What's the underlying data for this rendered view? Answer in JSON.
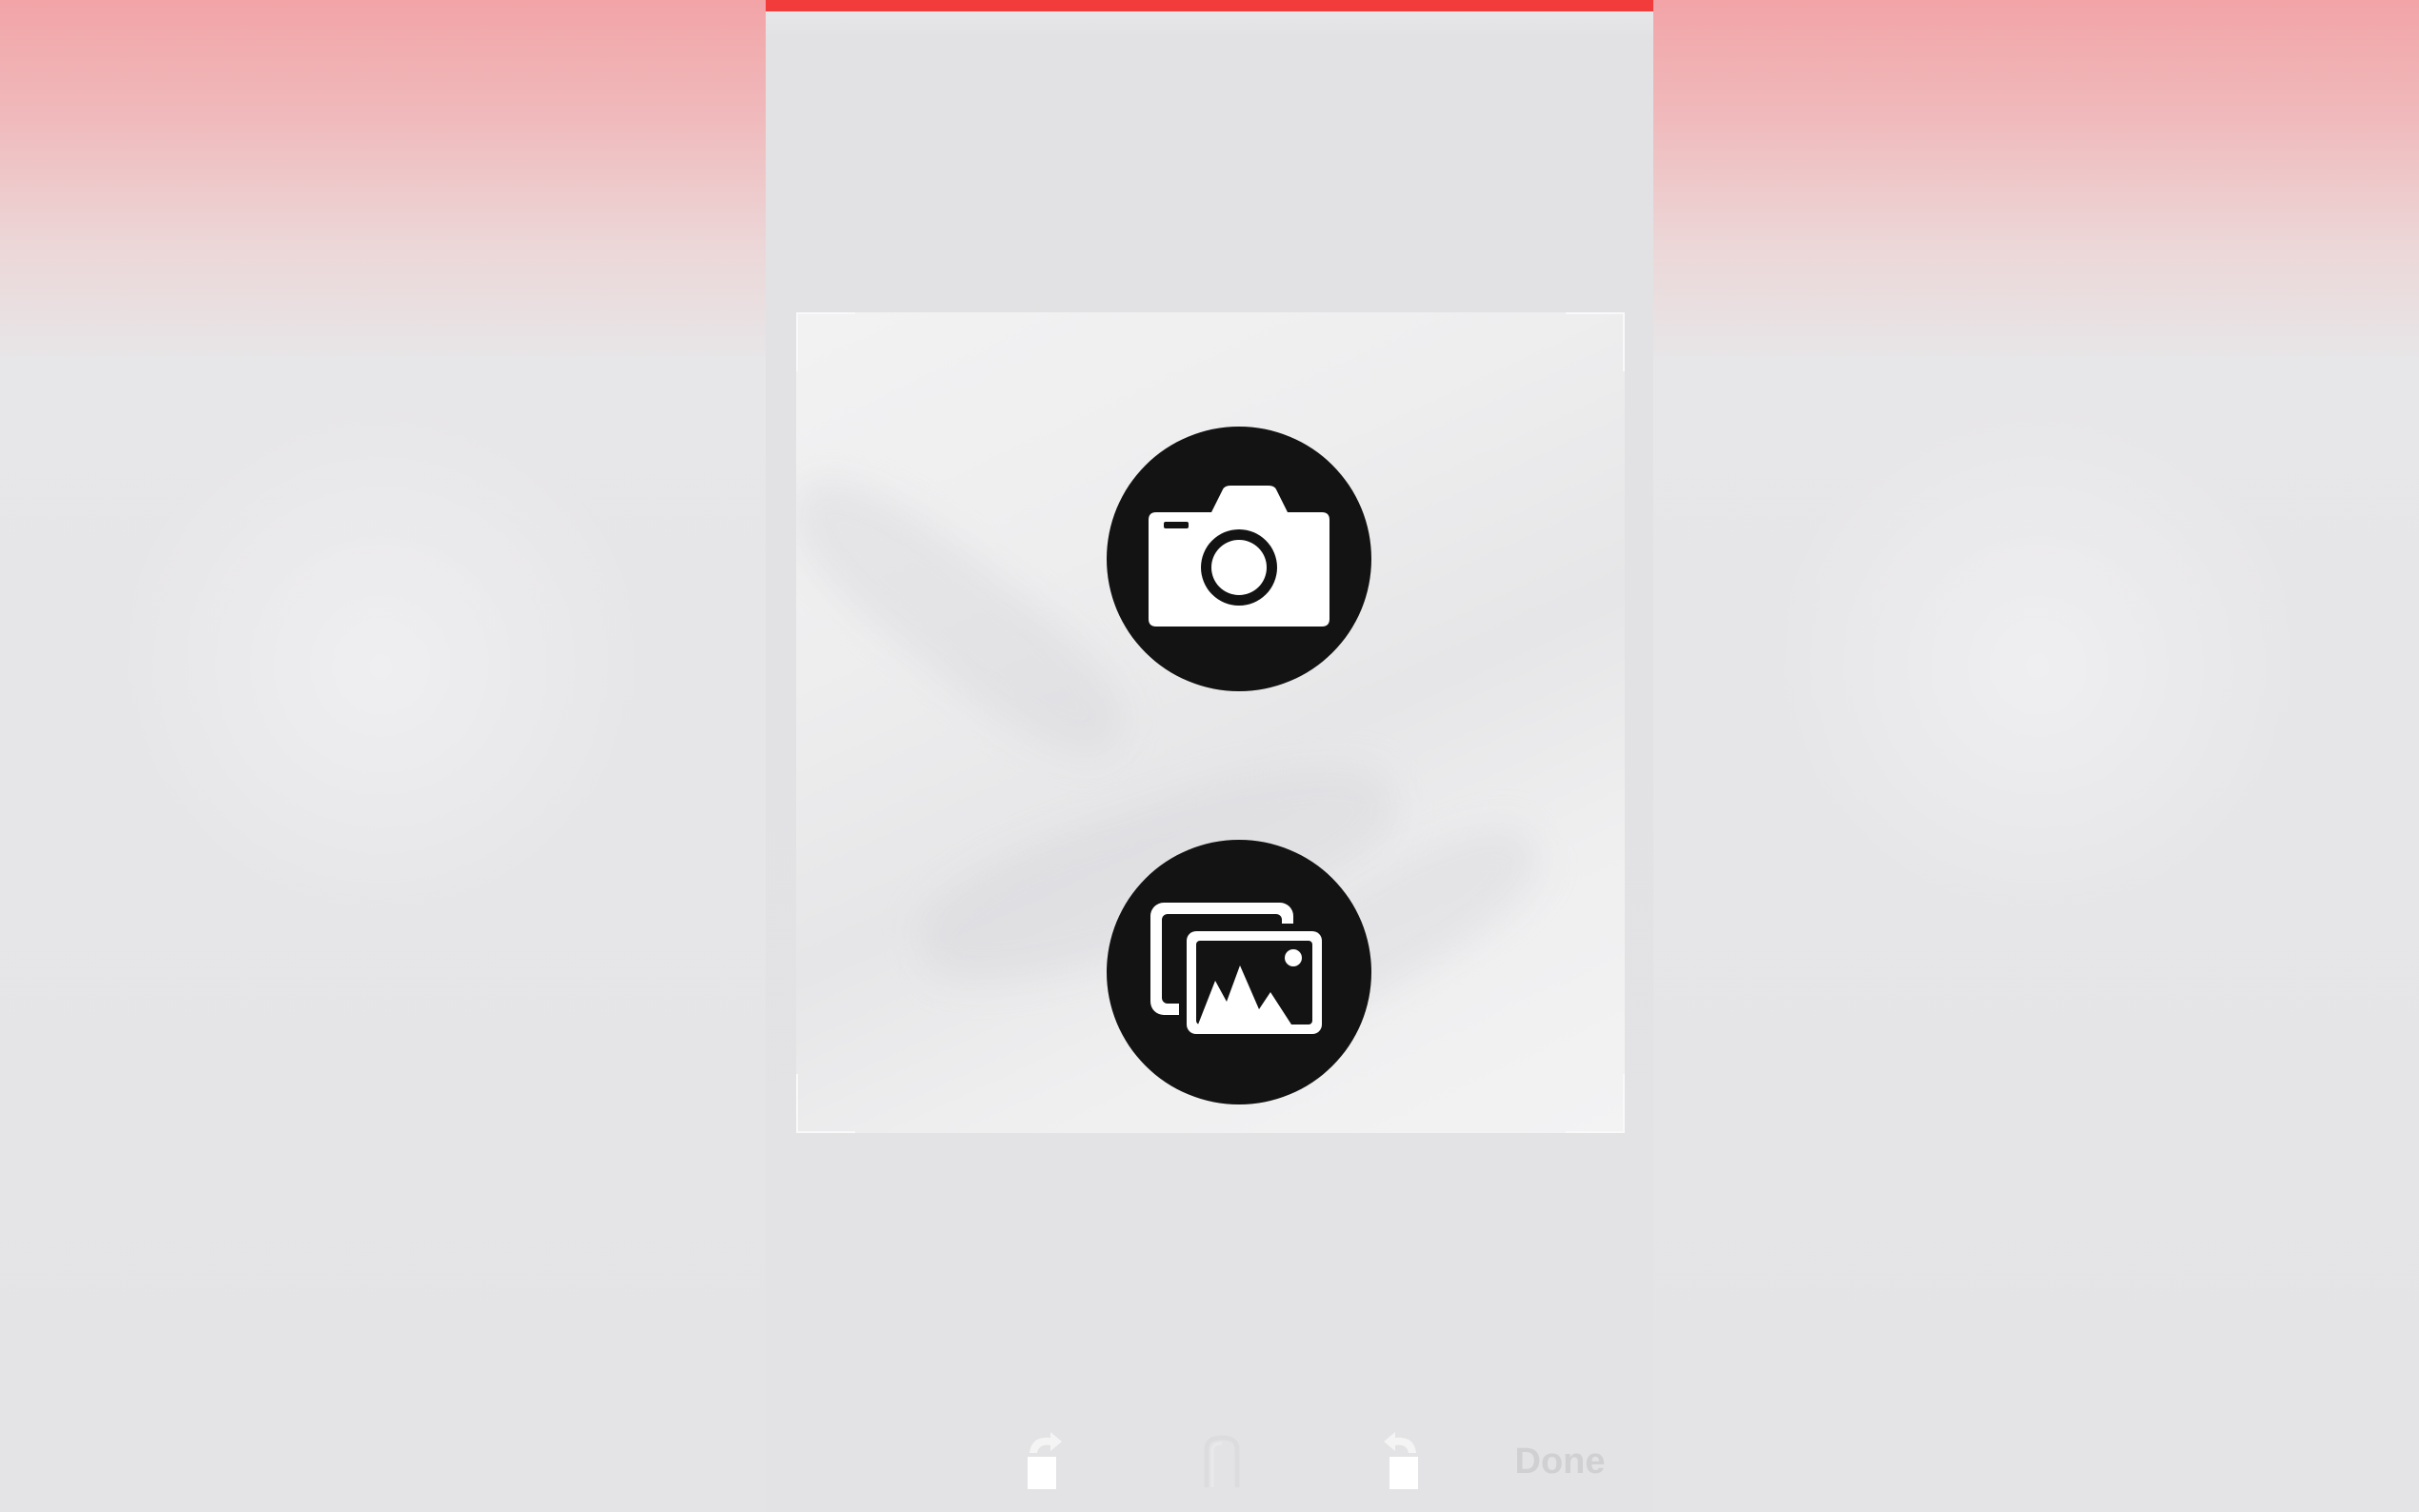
{
  "colors": {
    "accent_bar": "#f23b3b",
    "button_fill": "#131313",
    "icon_fill": "#ffffff"
  },
  "crop": {
    "camera_icon": "camera-icon",
    "gallery_icon": "photo-gallery-icon"
  },
  "toolbar": {
    "cancel_label": "",
    "rotate_left_icon": "rotate-left-icon",
    "reset_icon": "reset-icon",
    "rotate_right_icon": "rotate-right-icon",
    "done_label": "Done"
  }
}
